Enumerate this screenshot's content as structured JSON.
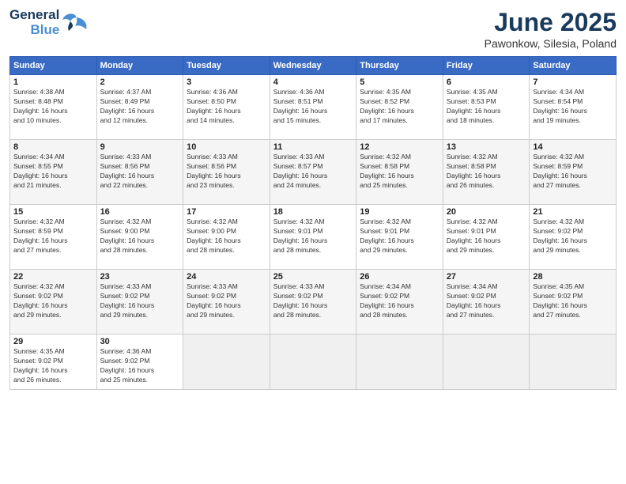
{
  "header": {
    "logo_line1": "General",
    "logo_line2": "Blue",
    "month": "June 2025",
    "location": "Pawonkow, Silesia, Poland"
  },
  "weekdays": [
    "Sunday",
    "Monday",
    "Tuesday",
    "Wednesday",
    "Thursday",
    "Friday",
    "Saturday"
  ],
  "weeks": [
    [
      {
        "day": "1",
        "rise": "4:38 AM",
        "set": "8:48 PM",
        "daylight": "16 hours and 10 minutes."
      },
      {
        "day": "2",
        "rise": "4:37 AM",
        "set": "8:49 PM",
        "daylight": "16 hours and 12 minutes."
      },
      {
        "day": "3",
        "rise": "4:36 AM",
        "set": "8:50 PM",
        "daylight": "16 hours and 14 minutes."
      },
      {
        "day": "4",
        "rise": "4:36 AM",
        "set": "8:51 PM",
        "daylight": "16 hours and 15 minutes."
      },
      {
        "day": "5",
        "rise": "4:35 AM",
        "set": "8:52 PM",
        "daylight": "16 hours and 17 minutes."
      },
      {
        "day": "6",
        "rise": "4:35 AM",
        "set": "8:53 PM",
        "daylight": "16 hours and 18 minutes."
      },
      {
        "day": "7",
        "rise": "4:34 AM",
        "set": "8:54 PM",
        "daylight": "16 hours and 19 minutes."
      }
    ],
    [
      {
        "day": "8",
        "rise": "4:34 AM",
        "set": "8:55 PM",
        "daylight": "16 hours and 21 minutes."
      },
      {
        "day": "9",
        "rise": "4:33 AM",
        "set": "8:56 PM",
        "daylight": "16 hours and 22 minutes."
      },
      {
        "day": "10",
        "rise": "4:33 AM",
        "set": "8:56 PM",
        "daylight": "16 hours and 23 minutes."
      },
      {
        "day": "11",
        "rise": "4:33 AM",
        "set": "8:57 PM",
        "daylight": "16 hours and 24 minutes."
      },
      {
        "day": "12",
        "rise": "4:32 AM",
        "set": "8:58 PM",
        "daylight": "16 hours and 25 minutes."
      },
      {
        "day": "13",
        "rise": "4:32 AM",
        "set": "8:58 PM",
        "daylight": "16 hours and 26 minutes."
      },
      {
        "day": "14",
        "rise": "4:32 AM",
        "set": "8:59 PM",
        "daylight": "16 hours and 27 minutes."
      }
    ],
    [
      {
        "day": "15",
        "rise": "4:32 AM",
        "set": "8:59 PM",
        "daylight": "16 hours and 27 minutes."
      },
      {
        "day": "16",
        "rise": "4:32 AM",
        "set": "9:00 PM",
        "daylight": "16 hours and 28 minutes."
      },
      {
        "day": "17",
        "rise": "4:32 AM",
        "set": "9:00 PM",
        "daylight": "16 hours and 28 minutes."
      },
      {
        "day": "18",
        "rise": "4:32 AM",
        "set": "9:01 PM",
        "daylight": "16 hours and 28 minutes."
      },
      {
        "day": "19",
        "rise": "4:32 AM",
        "set": "9:01 PM",
        "daylight": "16 hours and 29 minutes."
      },
      {
        "day": "20",
        "rise": "4:32 AM",
        "set": "9:01 PM",
        "daylight": "16 hours and 29 minutes."
      },
      {
        "day": "21",
        "rise": "4:32 AM",
        "set": "9:02 PM",
        "daylight": "16 hours and 29 minutes."
      }
    ],
    [
      {
        "day": "22",
        "rise": "4:32 AM",
        "set": "9:02 PM",
        "daylight": "16 hours and 29 minutes."
      },
      {
        "day": "23",
        "rise": "4:33 AM",
        "set": "9:02 PM",
        "daylight": "16 hours and 29 minutes."
      },
      {
        "day": "24",
        "rise": "4:33 AM",
        "set": "9:02 PM",
        "daylight": "16 hours and 29 minutes."
      },
      {
        "day": "25",
        "rise": "4:33 AM",
        "set": "9:02 PM",
        "daylight": "16 hours and 28 minutes."
      },
      {
        "day": "26",
        "rise": "4:34 AM",
        "set": "9:02 PM",
        "daylight": "16 hours and 28 minutes."
      },
      {
        "day": "27",
        "rise": "4:34 AM",
        "set": "9:02 PM",
        "daylight": "16 hours and 27 minutes."
      },
      {
        "day": "28",
        "rise": "4:35 AM",
        "set": "9:02 PM",
        "daylight": "16 hours and 27 minutes."
      }
    ],
    [
      {
        "day": "29",
        "rise": "4:35 AM",
        "set": "9:02 PM",
        "daylight": "16 hours and 26 minutes."
      },
      {
        "day": "30",
        "rise": "4:36 AM",
        "set": "9:02 PM",
        "daylight": "16 hours and 25 minutes."
      },
      null,
      null,
      null,
      null,
      null
    ]
  ]
}
